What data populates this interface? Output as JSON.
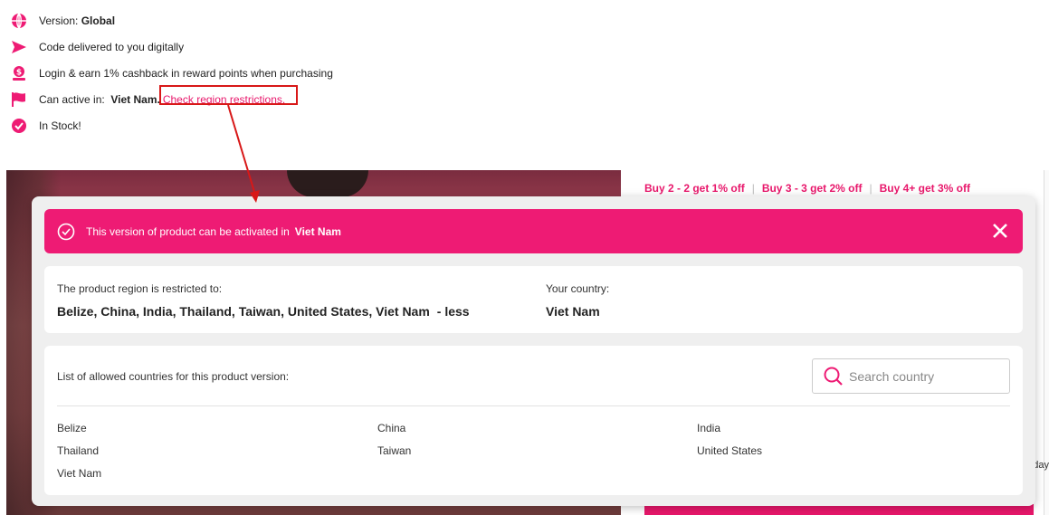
{
  "info": {
    "version_label": "Version:",
    "version_value": "Global",
    "delivery": "Code delivered to you digitally",
    "cashback": "Login & earn 1% cashback in reward points when purchasing",
    "active_label": "Can active in:",
    "active_value": "Viet Nam.",
    "region_link": "Check region restrictions.",
    "stock": "In Stock!"
  },
  "background": {
    "promo": [
      "Buy 2 - 2 get 1% off",
      "Buy 3 - 3 get 2% off",
      "Buy 4+ get 3% off"
    ],
    "edge_text": "day"
  },
  "modal": {
    "header_text": "This version of product can be activated in",
    "header_country": "Viet Nam",
    "restricted_label": "The product region is restricted to:",
    "restricted_value": "Belize, China, India, Thailand, Taiwan, United States, Viet Nam",
    "less_link": "- less",
    "your_country_label": "Your country:",
    "your_country_value": "Viet Nam",
    "allowed_label": "List of allowed countries for this product version:",
    "search_placeholder": "Search country",
    "countries": [
      "Belize",
      "China",
      "India",
      "Thailand",
      "Taiwan",
      "United States",
      "Viet Nam"
    ]
  },
  "colors": {
    "accent": "#ee1b74",
    "link": "#e8176b",
    "callout": "#d81818"
  }
}
